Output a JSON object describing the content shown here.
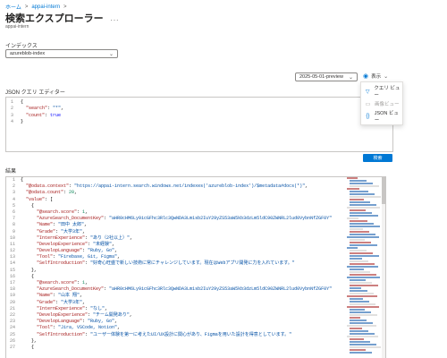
{
  "breadcrumb": {
    "home": "ホーム",
    "sep": ">",
    "service": "appai-intern",
    "sep2": ">"
  },
  "page": {
    "title": "検索エクスプローラー",
    "more": "...",
    "subtitle": "appai-intern"
  },
  "index": {
    "label": "インデックス",
    "value": "azureblob-index"
  },
  "api_version": {
    "value": "2025-05-01-preview"
  },
  "view": {
    "label": "表示",
    "menu": [
      {
        "label": "クエリ ビュー",
        "icon": "filter-icon",
        "disabled": false
      },
      {
        "label": "画像ビュー",
        "icon": "image-icon",
        "disabled": true
      },
      {
        "label": "JSON ビュー",
        "icon": "braces-icon",
        "disabled": false
      }
    ]
  },
  "query_editor": {
    "label": "JSON クエリ エディター",
    "lines": [
      {
        "n": "1",
        "parts": [
          [
            "p",
            "{"
          ]
        ]
      },
      {
        "n": "2",
        "parts": [
          [
            "p",
            "  "
          ],
          [
            "k",
            "\"search\""
          ],
          [
            "p",
            ": "
          ],
          [
            "s",
            "\"*\""
          ],
          [
            "p",
            ","
          ]
        ]
      },
      {
        "n": "3",
        "parts": [
          [
            "p",
            "  "
          ],
          [
            "k",
            "\"count\""
          ],
          [
            "p",
            ": "
          ],
          [
            "b",
            "true"
          ]
        ]
      },
      {
        "n": "4",
        "parts": [
          [
            "p",
            "}"
          ]
        ]
      }
    ]
  },
  "search_button": {
    "label": "検索"
  },
  "results": {
    "label": "結果",
    "lines": [
      {
        "n": "1",
        "parts": [
          [
            "p",
            "{"
          ]
        ]
      },
      {
        "n": "2",
        "parts": [
          [
            "p",
            "  "
          ],
          [
            "k",
            "\"@odata.context\""
          ],
          [
            "p",
            ": "
          ],
          [
            "s",
            "\"https://appai-intern.search.windows.net/indexes('azureblob-index')/$metadata#docs(*)\""
          ],
          [
            "p",
            ","
          ]
        ]
      },
      {
        "n": "3",
        "parts": [
          [
            "p",
            "  "
          ],
          [
            "k",
            "\"@odata.count\""
          ],
          [
            "p",
            ": "
          ],
          [
            "n",
            "20"
          ],
          [
            "p",
            ","
          ]
        ]
      },
      {
        "n": "4",
        "parts": [
          [
            "p",
            "  "
          ],
          [
            "k",
            "\"value\""
          ],
          [
            "p",
            ": ["
          ]
        ]
      },
      {
        "n": "5",
        "parts": [
          [
            "p",
            "    {"
          ]
        ]
      },
      {
        "n": "6",
        "parts": [
          [
            "p",
            "      "
          ],
          [
            "k",
            "\"@search.score\""
          ],
          [
            "p",
            ": "
          ],
          [
            "n",
            "1"
          ],
          [
            "p",
            ","
          ]
        ]
      },
      {
        "n": "7",
        "parts": [
          [
            "p",
            "      "
          ],
          [
            "k",
            "\"AzureSearch_DocumentKey\""
          ],
          [
            "p",
            ": "
          ],
          [
            "s",
            "\"aHR0cHM6Ly9icGFhc3Rlc3QwNDA3Lm1sb2IuY29yZS53aW5kb3dzLm5ldC90ZWNRL2lud0VybnNfZGF0Y\""
          ]
        ]
      },
      {
        "n": "8",
        "parts": [
          [
            "p",
            "      "
          ],
          [
            "k",
            "\"Name\""
          ],
          [
            "p",
            ": "
          ],
          [
            "s",
            "\"田中 太郎\""
          ],
          [
            "p",
            ","
          ]
        ]
      },
      {
        "n": "9",
        "parts": [
          [
            "p",
            "      "
          ],
          [
            "k",
            "\"Grade\""
          ],
          [
            "p",
            ": "
          ],
          [
            "s",
            "\"大学3年\""
          ],
          [
            "p",
            ","
          ]
        ]
      },
      {
        "n": "10",
        "parts": [
          [
            "p",
            "      "
          ],
          [
            "k",
            "\"InternExperience\""
          ],
          [
            "p",
            ": "
          ],
          [
            "s",
            "\"あり（2社以上）\""
          ],
          [
            "p",
            ","
          ]
        ]
      },
      {
        "n": "11",
        "parts": [
          [
            "p",
            "      "
          ],
          [
            "k",
            "\"DevelopExperience\""
          ],
          [
            "p",
            ": "
          ],
          [
            "s",
            "\"未経験\""
          ],
          [
            "p",
            ","
          ]
        ]
      },
      {
        "n": "12",
        "parts": [
          [
            "p",
            "      "
          ],
          [
            "k",
            "\"DevelopLanguage\""
          ],
          [
            "p",
            ": "
          ],
          [
            "s",
            "\"Ruby, Go\""
          ],
          [
            "p",
            ","
          ]
        ]
      },
      {
        "n": "13",
        "parts": [
          [
            "p",
            "      "
          ],
          [
            "k",
            "\"Tool\""
          ],
          [
            "p",
            ": "
          ],
          [
            "s",
            "\"Firebase, Git, Figma\""
          ],
          [
            "p",
            ","
          ]
        ]
      },
      {
        "n": "14",
        "parts": [
          [
            "p",
            "      "
          ],
          [
            "k",
            "\"SelfIntroduction\""
          ],
          [
            "p",
            ": "
          ],
          [
            "s",
            "\"好奇心旺盛で新しい技術に常にチャレンジしています。現在はWebアプリ開発に力を入れています。\""
          ]
        ]
      },
      {
        "n": "15",
        "parts": [
          [
            "p",
            "    },"
          ]
        ]
      },
      {
        "n": "16",
        "parts": [
          [
            "p",
            "    {"
          ]
        ]
      },
      {
        "n": "17",
        "parts": [
          [
            "p",
            "      "
          ],
          [
            "k",
            "\"@search.score\""
          ],
          [
            "p",
            ": "
          ],
          [
            "n",
            "1"
          ],
          [
            "p",
            ","
          ]
        ]
      },
      {
        "n": "18",
        "parts": [
          [
            "p",
            "      "
          ],
          [
            "k",
            "\"AzureSearch_DocumentKey\""
          ],
          [
            "p",
            ": "
          ],
          [
            "s",
            "\"aHR0cHM6Ly9icGFhc3Rlc3QwNDA3Lm1sb2IuY29yZS53aW5kb3dzLm5ldC90ZWNRL2lud0VybnNfZGF0Y\""
          ]
        ]
      },
      {
        "n": "19",
        "parts": [
          [
            "p",
            "      "
          ],
          [
            "k",
            "\"Name\""
          ],
          [
            "p",
            ": "
          ],
          [
            "s",
            "\"山本 翔\""
          ],
          [
            "p",
            ","
          ]
        ]
      },
      {
        "n": "20",
        "parts": [
          [
            "p",
            "      "
          ],
          [
            "k",
            "\"Grade\""
          ],
          [
            "p",
            ": "
          ],
          [
            "s",
            "\"大学3年\""
          ],
          [
            "p",
            ","
          ]
        ]
      },
      {
        "n": "21",
        "parts": [
          [
            "p",
            "      "
          ],
          [
            "k",
            "\"InternExperience\""
          ],
          [
            "p",
            ": "
          ],
          [
            "s",
            "\"なし\""
          ],
          [
            "p",
            ","
          ]
        ]
      },
      {
        "n": "22",
        "parts": [
          [
            "p",
            "      "
          ],
          [
            "k",
            "\"DevelopExperience\""
          ],
          [
            "p",
            ": "
          ],
          [
            "s",
            "\"チーム開発あり\""
          ],
          [
            "p",
            ","
          ]
        ]
      },
      {
        "n": "23",
        "parts": [
          [
            "p",
            "      "
          ],
          [
            "k",
            "\"DevelopLanguage\""
          ],
          [
            "p",
            ": "
          ],
          [
            "s",
            "\"Ruby, Go\""
          ],
          [
            "p",
            ","
          ]
        ]
      },
      {
        "n": "24",
        "parts": [
          [
            "p",
            "      "
          ],
          [
            "k",
            "\"Tool\""
          ],
          [
            "p",
            ": "
          ],
          [
            "s",
            "\"Jira, VSCode, Notion\""
          ],
          [
            "p",
            ","
          ]
        ]
      },
      {
        "n": "25",
        "parts": [
          [
            "p",
            "      "
          ],
          [
            "k",
            "\"SelfIntroduction\""
          ],
          [
            "p",
            ": "
          ],
          [
            "s",
            "\"ユーザー体験を第一に考えたUI/UX設計に関心があり、Figmaを用いた設計を得意としています。\""
          ]
        ]
      },
      {
        "n": "26",
        "parts": [
          [
            "p",
            "    },"
          ]
        ]
      },
      {
        "n": "27",
        "parts": [
          [
            "p",
            "    {"
          ]
        ]
      }
    ]
  },
  "colors": {
    "accent": "#0078d4",
    "key": "#a31515",
    "string": "#0451a5",
    "number": "#098658",
    "bool": "#0000ff"
  }
}
